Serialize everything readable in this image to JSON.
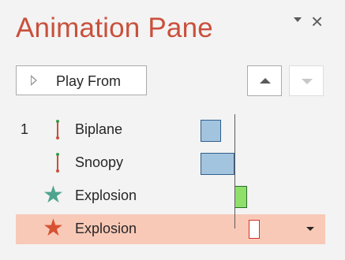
{
  "pane": {
    "title": "Animation Pane",
    "accent_color": "#c9503b"
  },
  "toolbar": {
    "play_from_label": "Play From",
    "play_icon": "play-icon",
    "move_up_icon": "chevron-up-icon",
    "move_down_icon": "chevron-down-icon"
  },
  "animations": [
    {
      "number": "1",
      "name": "Biplane",
      "effect": "motion-path",
      "color": "#a3c4df"
    },
    {
      "number": "",
      "name": "Snoopy",
      "effect": "motion-path",
      "color": "#a3c4df"
    },
    {
      "number": "",
      "name": "Explosion",
      "effect": "entrance",
      "color": "#8ee06a"
    },
    {
      "number": "",
      "name": "Explosion",
      "effect": "exit",
      "color": "#d3312a",
      "selected": true
    }
  ]
}
